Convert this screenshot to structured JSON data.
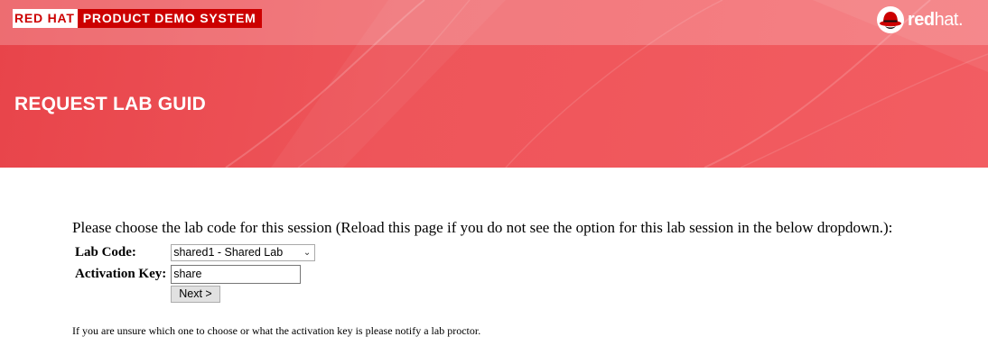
{
  "header": {
    "brand_part1": "RED HAT",
    "brand_part2": "PRODUCT DEMO SYSTEM",
    "logo_bold": "red",
    "logo_light": "hat.",
    "page_title": "REQUEST LAB GUID"
  },
  "form": {
    "instructions": "Please choose the lab code for this session (Reload this page if you do not see the option for this lab session in the below dropdown.):",
    "lab_code_label": "Lab Code:",
    "lab_code_selected": "shared1 - Shared Lab",
    "activation_key_label": "Activation Key:",
    "activation_key_value": "share",
    "next_button": "Next >"
  },
  "footer_note": "If you are unsure which one to choose or what the activation key is please notify a lab proctor.",
  "colors": {
    "banner": "#ee555a",
    "brand_red": "#cc0000"
  },
  "icons": {
    "logo": "red-hat-shadowman-icon",
    "dropdown": "chevron-down-icon"
  }
}
